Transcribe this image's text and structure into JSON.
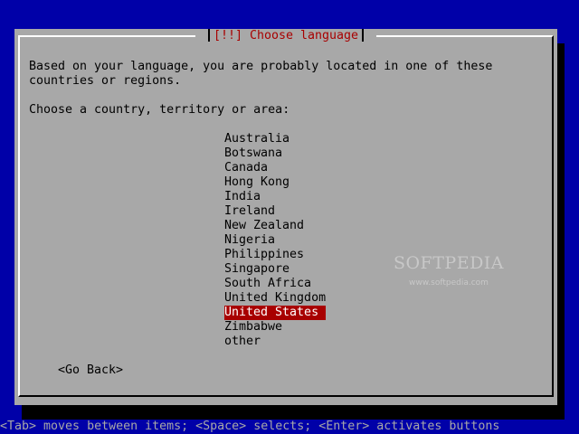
{
  "dialog": {
    "title": "[!!] Choose language",
    "intro_line_1": "Based on your language, you are probably located in one of these",
    "intro_line_2": "countries or regions.",
    "prompt": "Choose a country, territory or area:",
    "countries": [
      "Australia",
      "Botswana",
      "Canada",
      "Hong Kong",
      "India",
      "Ireland",
      "New Zealand",
      "Nigeria",
      "Philippines",
      "Singapore",
      "South Africa",
      "United Kingdom",
      "United States",
      "Zimbabwe",
      "other"
    ],
    "selected": "United States",
    "go_back": "<Go Back>"
  },
  "watermark": {
    "logo": "SOFTPEDIA",
    "url": "www.softpedia.com"
  },
  "status_bar": "<Tab> moves between items; <Space> selects; <Enter> activates buttons",
  "colors": {
    "background": "#0000a8",
    "dialog": "#a8a8a8",
    "title": "#a80000",
    "selection": "#a80000",
    "selection_text": "#ffffff"
  }
}
